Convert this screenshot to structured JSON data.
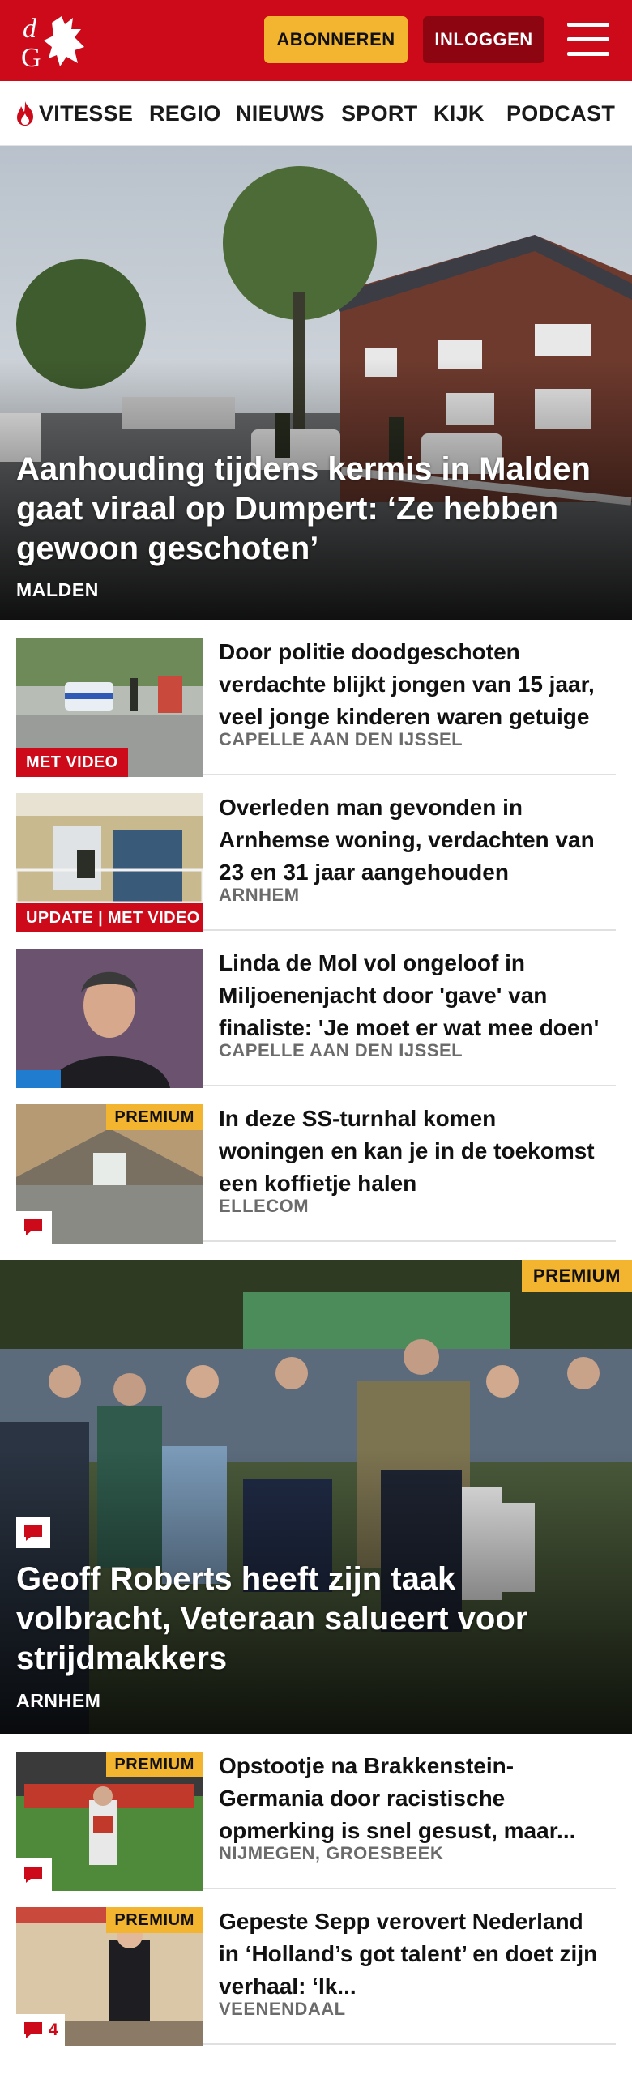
{
  "header": {
    "logo_alt": "dG",
    "subscribe_label": "ABONNEREN",
    "login_label": "INLOGGEN",
    "brand_color": "#cc0a1a",
    "accent_color": "#f3b52f"
  },
  "nav": {
    "items": [
      {
        "label": "VITESSE",
        "icon": "flame-icon"
      },
      {
        "label": "REGIO"
      },
      {
        "label": "NIEUWS"
      },
      {
        "label": "SPORT"
      },
      {
        "label": "KIJK"
      },
      {
        "label": "PODCAST"
      }
    ]
  },
  "hero": {
    "title": "Aanhouding tijdens kermis in Malden gaat viraal op Dumpert: ‘Ze hebben gewoon geschoten’",
    "location": "MALDEN"
  },
  "articles": [
    {
      "title": "Door politie doodgeschoten verdachte blijkt jongen van 15 jaar, veel jonge kinderen waren getuige",
      "location": "CAPELLE AAN DEN IJSSEL",
      "badge": "MET VIDEO"
    },
    {
      "title": "Overleden man gevonden in Arnhemse woning, verdachten van 23 en 31 jaar aangehouden",
      "location": "ARNHEM",
      "badge": "UPDATE | MET VIDEO"
    },
    {
      "title": "Linda de Mol vol ongeloof in Miljoenenjacht door 'gave' van finaliste: 'Je moet er wat mee doen'",
      "location": "CAPELLE AAN DEN IJSSEL"
    },
    {
      "title": "In deze SS-turnhal komen woningen en kan je in de toekomst een koffietje halen",
      "location": "ELLECOM",
      "premium": "PREMIUM"
    }
  ],
  "feature": {
    "title": "Geoff Roberts heeft zijn taak volbracht, Veteraan salueert voor strijdmakkers",
    "location": "ARNHEM",
    "premium": "PREMIUM"
  },
  "articles2": [
    {
      "title": "Opstootje na Brakkenstein-Germania door racistische opmerking is snel gesust, maar...",
      "location": "NIJMEGEN, GROESBEEK",
      "premium": "PREMIUM"
    },
    {
      "title": "Gepeste Sepp verovert Nederland in ‘Holland’s got talent’ en doet zijn verhaal: ‘Ik...",
      "location": "VEENENDAAL",
      "premium": "PREMIUM",
      "comments": "4"
    }
  ]
}
